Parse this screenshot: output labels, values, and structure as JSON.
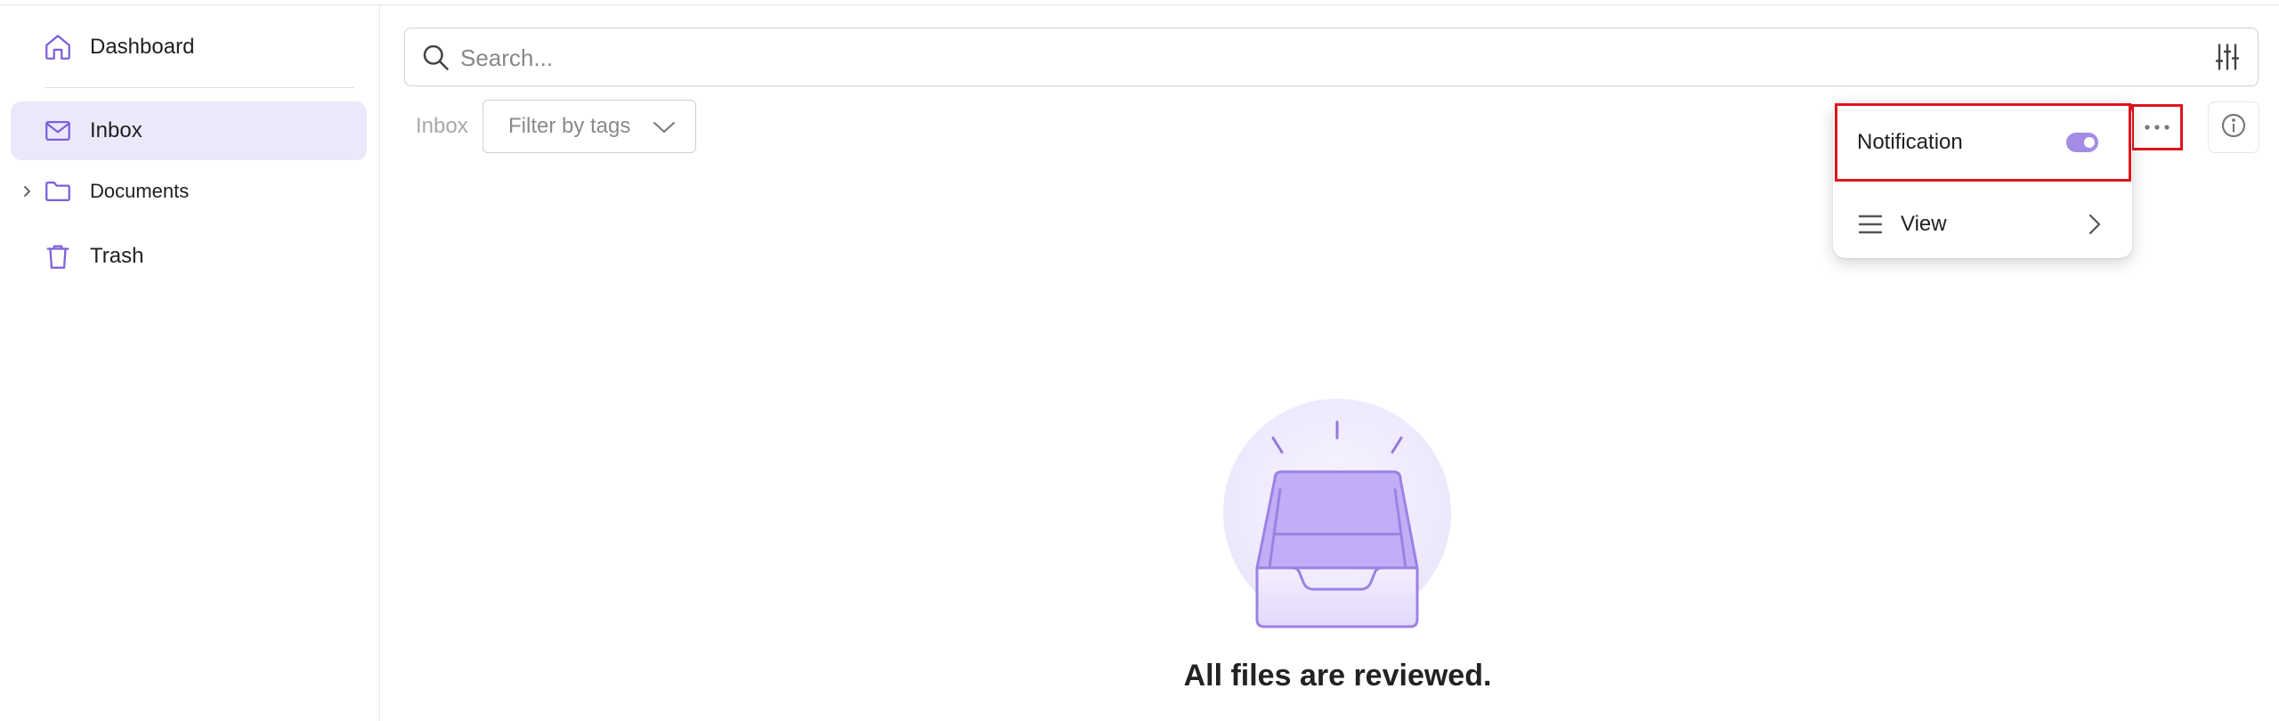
{
  "sidebar": {
    "items": [
      {
        "label": "Dashboard",
        "icon": "home-icon"
      },
      {
        "label": "Inbox",
        "icon": "mail-icon",
        "active": true
      },
      {
        "label": "Documents",
        "icon": "folder-icon",
        "expandable": true
      },
      {
        "label": "Trash",
        "icon": "trash-icon"
      }
    ]
  },
  "search": {
    "placeholder": "Search..."
  },
  "toolbar": {
    "breadcrumb": "Inbox",
    "filter_label": "Filter by tags"
  },
  "menu": {
    "notification_label": "Notification",
    "notification_enabled": true,
    "view_label": "View"
  },
  "empty_state": {
    "message": "All files are reviewed."
  },
  "colors": {
    "accent": "#7c5fdc",
    "active_bg": "#ece8fb",
    "toggle": "#a48be6",
    "highlight": "#e0141e"
  }
}
